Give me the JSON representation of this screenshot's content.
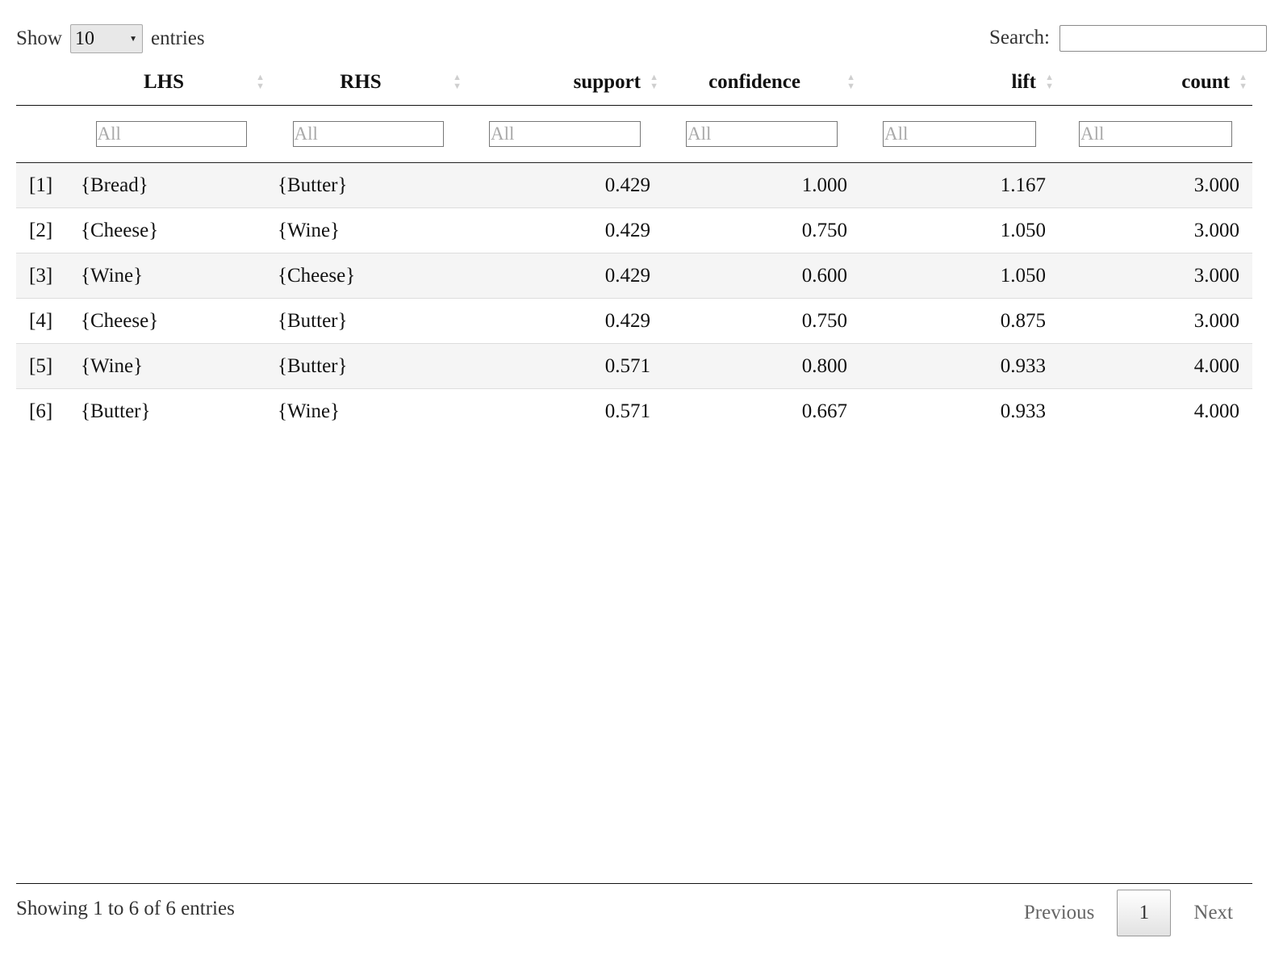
{
  "length_menu": {
    "prefix": "Show",
    "selected": "10",
    "suffix": "entries"
  },
  "search": {
    "label": "Search:",
    "value": ""
  },
  "table": {
    "columns": [
      {
        "label": ""
      },
      {
        "label": "LHS"
      },
      {
        "label": "RHS"
      },
      {
        "label": "support"
      },
      {
        "label": "confidence"
      },
      {
        "label": "lift"
      },
      {
        "label": "count"
      }
    ],
    "filter_placeholder": "All",
    "rows": [
      {
        "idx": "[1]",
        "lhs": "{Bread}",
        "rhs": "{Butter}",
        "support": "0.429",
        "confidence": "1.000",
        "lift": "1.167",
        "count": "3.000"
      },
      {
        "idx": "[2]",
        "lhs": "{Cheese}",
        "rhs": "{Wine}",
        "support": "0.429",
        "confidence": "0.750",
        "lift": "1.050",
        "count": "3.000"
      },
      {
        "idx": "[3]",
        "lhs": "{Wine}",
        "rhs": "{Cheese}",
        "support": "0.429",
        "confidence": "0.600",
        "lift": "1.050",
        "count": "3.000"
      },
      {
        "idx": "[4]",
        "lhs": "{Cheese}",
        "rhs": "{Butter}",
        "support": "0.429",
        "confidence": "0.750",
        "lift": "0.875",
        "count": "3.000"
      },
      {
        "idx": "[5]",
        "lhs": "{Wine}",
        "rhs": "{Butter}",
        "support": "0.571",
        "confidence": "0.800",
        "lift": "0.933",
        "count": "4.000"
      },
      {
        "idx": "[6]",
        "lhs": "{Butter}",
        "rhs": "{Wine}",
        "support": "0.571",
        "confidence": "0.667",
        "lift": "0.933",
        "count": "4.000"
      }
    ]
  },
  "footer": {
    "info": "Showing 1 to 6 of 6 entries",
    "previous": "Previous",
    "current_page": "1",
    "next": "Next"
  },
  "colors": {
    "odd_row_bg": "#f5f5f5",
    "placeholder": "#a9a9a9",
    "sort_icon": "#cfcfcf"
  },
  "icons": {
    "length_caret": "caret-down-icon",
    "sort": "sort-both-icon"
  }
}
